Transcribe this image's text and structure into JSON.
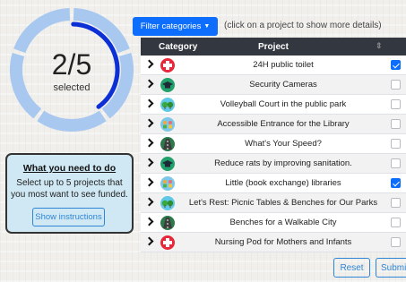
{
  "selection": {
    "display": "2/5",
    "selected_count": 2,
    "max_count": 5,
    "label": "selected",
    "colors": {
      "track": "#a8c8ef",
      "fill": "#0d2fd6"
    }
  },
  "info_panel": {
    "title": "What you need to do",
    "text": "Select up to 5 projects that you most want to see funded.",
    "button_label": "Show instructions"
  },
  "filter": {
    "button_label": "Filter categories",
    "hint": "(click on a project to show more details)"
  },
  "table": {
    "columns": [
      "Category",
      "Project"
    ],
    "rows": [
      {
        "category_icon": "health-cross-icon",
        "project": "24H public toilet",
        "selected": true
      },
      {
        "category_icon": "education-cap-icon",
        "project": "Security Cameras",
        "selected": false
      },
      {
        "category_icon": "parks-trees-icon",
        "project": "Volleyball Court in the public park",
        "selected": false
      },
      {
        "category_icon": "community-people-icon",
        "project": "Accessible Entrance for the Library",
        "selected": false
      },
      {
        "category_icon": "road-icon",
        "project": "What's Your Speed?",
        "selected": false
      },
      {
        "category_icon": "education-cap-icon",
        "project": "Reduce rats by improving sanitation.",
        "selected": false
      },
      {
        "category_icon": "community-people-icon",
        "project": "Little (book exchange) libraries",
        "selected": true
      },
      {
        "category_icon": "parks-trees-icon",
        "project": "Let's Rest: Picnic Tables & Benches for Our Parks",
        "selected": false
      },
      {
        "category_icon": "road-icon",
        "project": "Benches for a Walkable City",
        "selected": false
      },
      {
        "category_icon": "health-cross-icon",
        "project": "Nursing Pod for Mothers and Infants",
        "selected": false
      }
    ]
  },
  "actions": {
    "reset_label": "Reset",
    "submit_label": "Submit"
  },
  "colors": {
    "primary": "#0d6efd",
    "header_bg": "#333740",
    "info_bg": "#cfe8f3",
    "health": "#e8283a",
    "education": "#22a06b",
    "parks": "#3aa83a",
    "community": "#f2a93b",
    "road": "#2c7a4b"
  }
}
